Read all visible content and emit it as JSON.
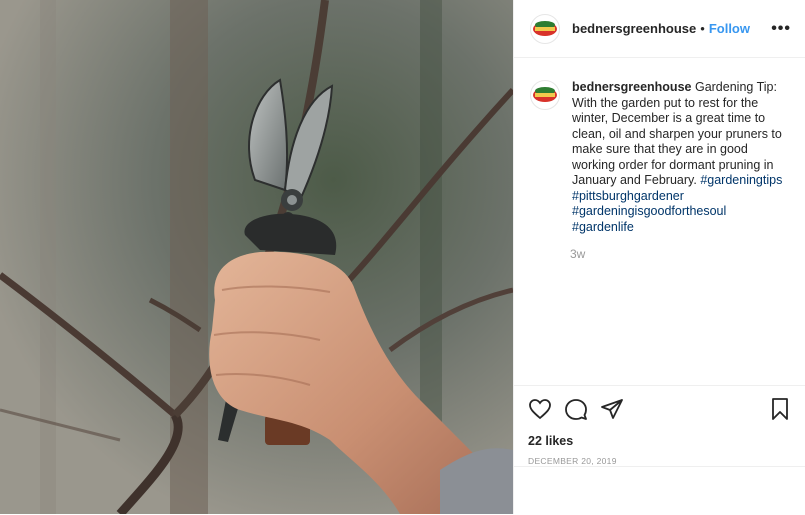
{
  "post": {
    "username": "bednersgreenhouse",
    "follow_label": "Follow",
    "separator": "•",
    "more_label": "•••",
    "logo_text": "BEDNER'S",
    "caption": {
      "username": "bednersgreenhouse",
      "text": "Gardening Tip: With the garden put to rest for the winter, December is a great time to clean, oil and sharpen your pruners to make sure that they are in good working order for dormant pruning in January and February.",
      "hashtags": [
        "#gardeningtips",
        "#pittsburghgardener",
        "#gardeningisgoodforthesoul",
        "#gardenlife"
      ]
    },
    "time_ago": "3w",
    "likes": "22 likes",
    "date": "DECEMBER 20, 2019"
  },
  "colors": {
    "link_blue": "#3897f0",
    "hashtag": "#003569",
    "logo_red": "#d8322a",
    "logo_green": "#2e7d32"
  },
  "icons": [
    "heart-icon",
    "comment-icon",
    "share-icon",
    "bookmark-icon"
  ]
}
